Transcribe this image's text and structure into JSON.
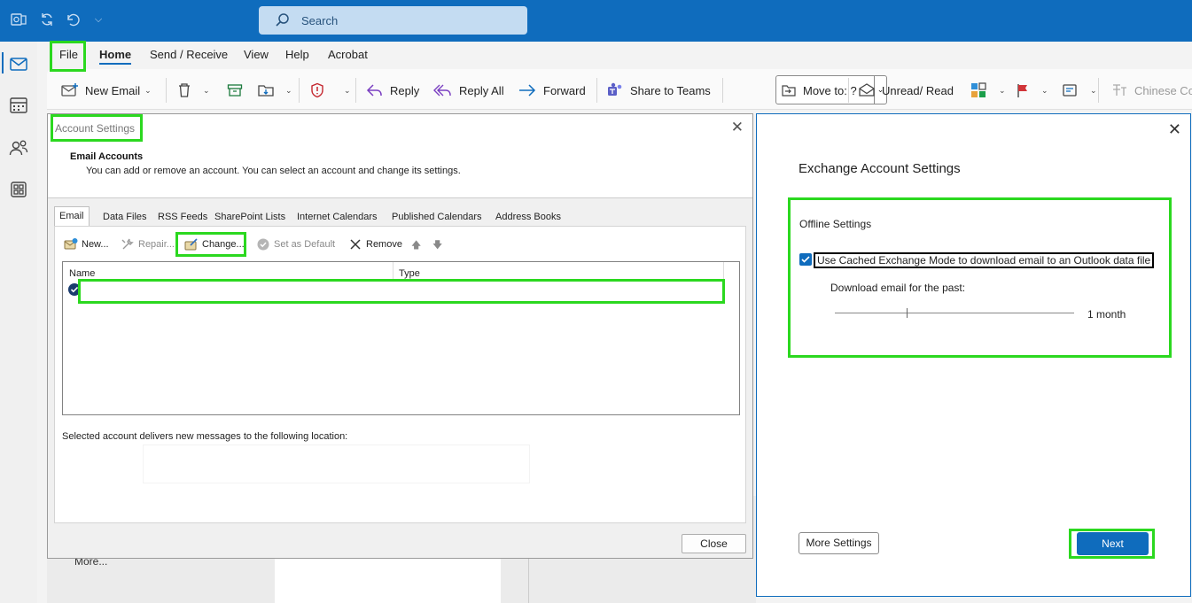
{
  "titlebar": {
    "search_placeholder": "Search"
  },
  "menu": {
    "tabs": [
      "File",
      "Home",
      "Send / Receive",
      "View",
      "Help",
      "Acrobat"
    ]
  },
  "ribbon": {
    "new_email": "New Email",
    "reply": "Reply",
    "reply_all": "Reply All",
    "forward": "Forward",
    "share_to_teams": "Share to Teams",
    "move_to": "Move to: ?",
    "unread_read": "Unread/ Read",
    "chinese": "Chinese Co"
  },
  "background": {
    "more_label": "More..."
  },
  "account_settings": {
    "title": "Account Settings",
    "header_title": "Email Accounts",
    "header_subtitle": "You can add or remove an account. You can select an account and change its settings.",
    "tabs": [
      "Email",
      "Data Files",
      "RSS Feeds",
      "SharePoint Lists",
      "Internet Calendars",
      "Published Calendars",
      "Address Books"
    ],
    "toolbar": {
      "new": "New...",
      "repair": "Repair...",
      "change": "Change...",
      "set_default": "Set as Default",
      "remove": "Remove"
    },
    "columns": {
      "name": "Name",
      "type": "Type"
    },
    "deliver_label": "Selected account delivers new messages to the following location:",
    "close_label": "Close"
  },
  "exchange": {
    "title": "Exchange Account Settings",
    "offline_title": "Offline Settings",
    "cached_label": "Use Cached Exchange Mode to download email to an Outlook data file",
    "cached_checked": true,
    "download_label": "Download email for the past:",
    "download_value": "1 month",
    "more_settings": "More Settings",
    "next": "Next"
  },
  "colors": {
    "accent": "#0f6cbd",
    "highlight": "#2bd81f"
  }
}
